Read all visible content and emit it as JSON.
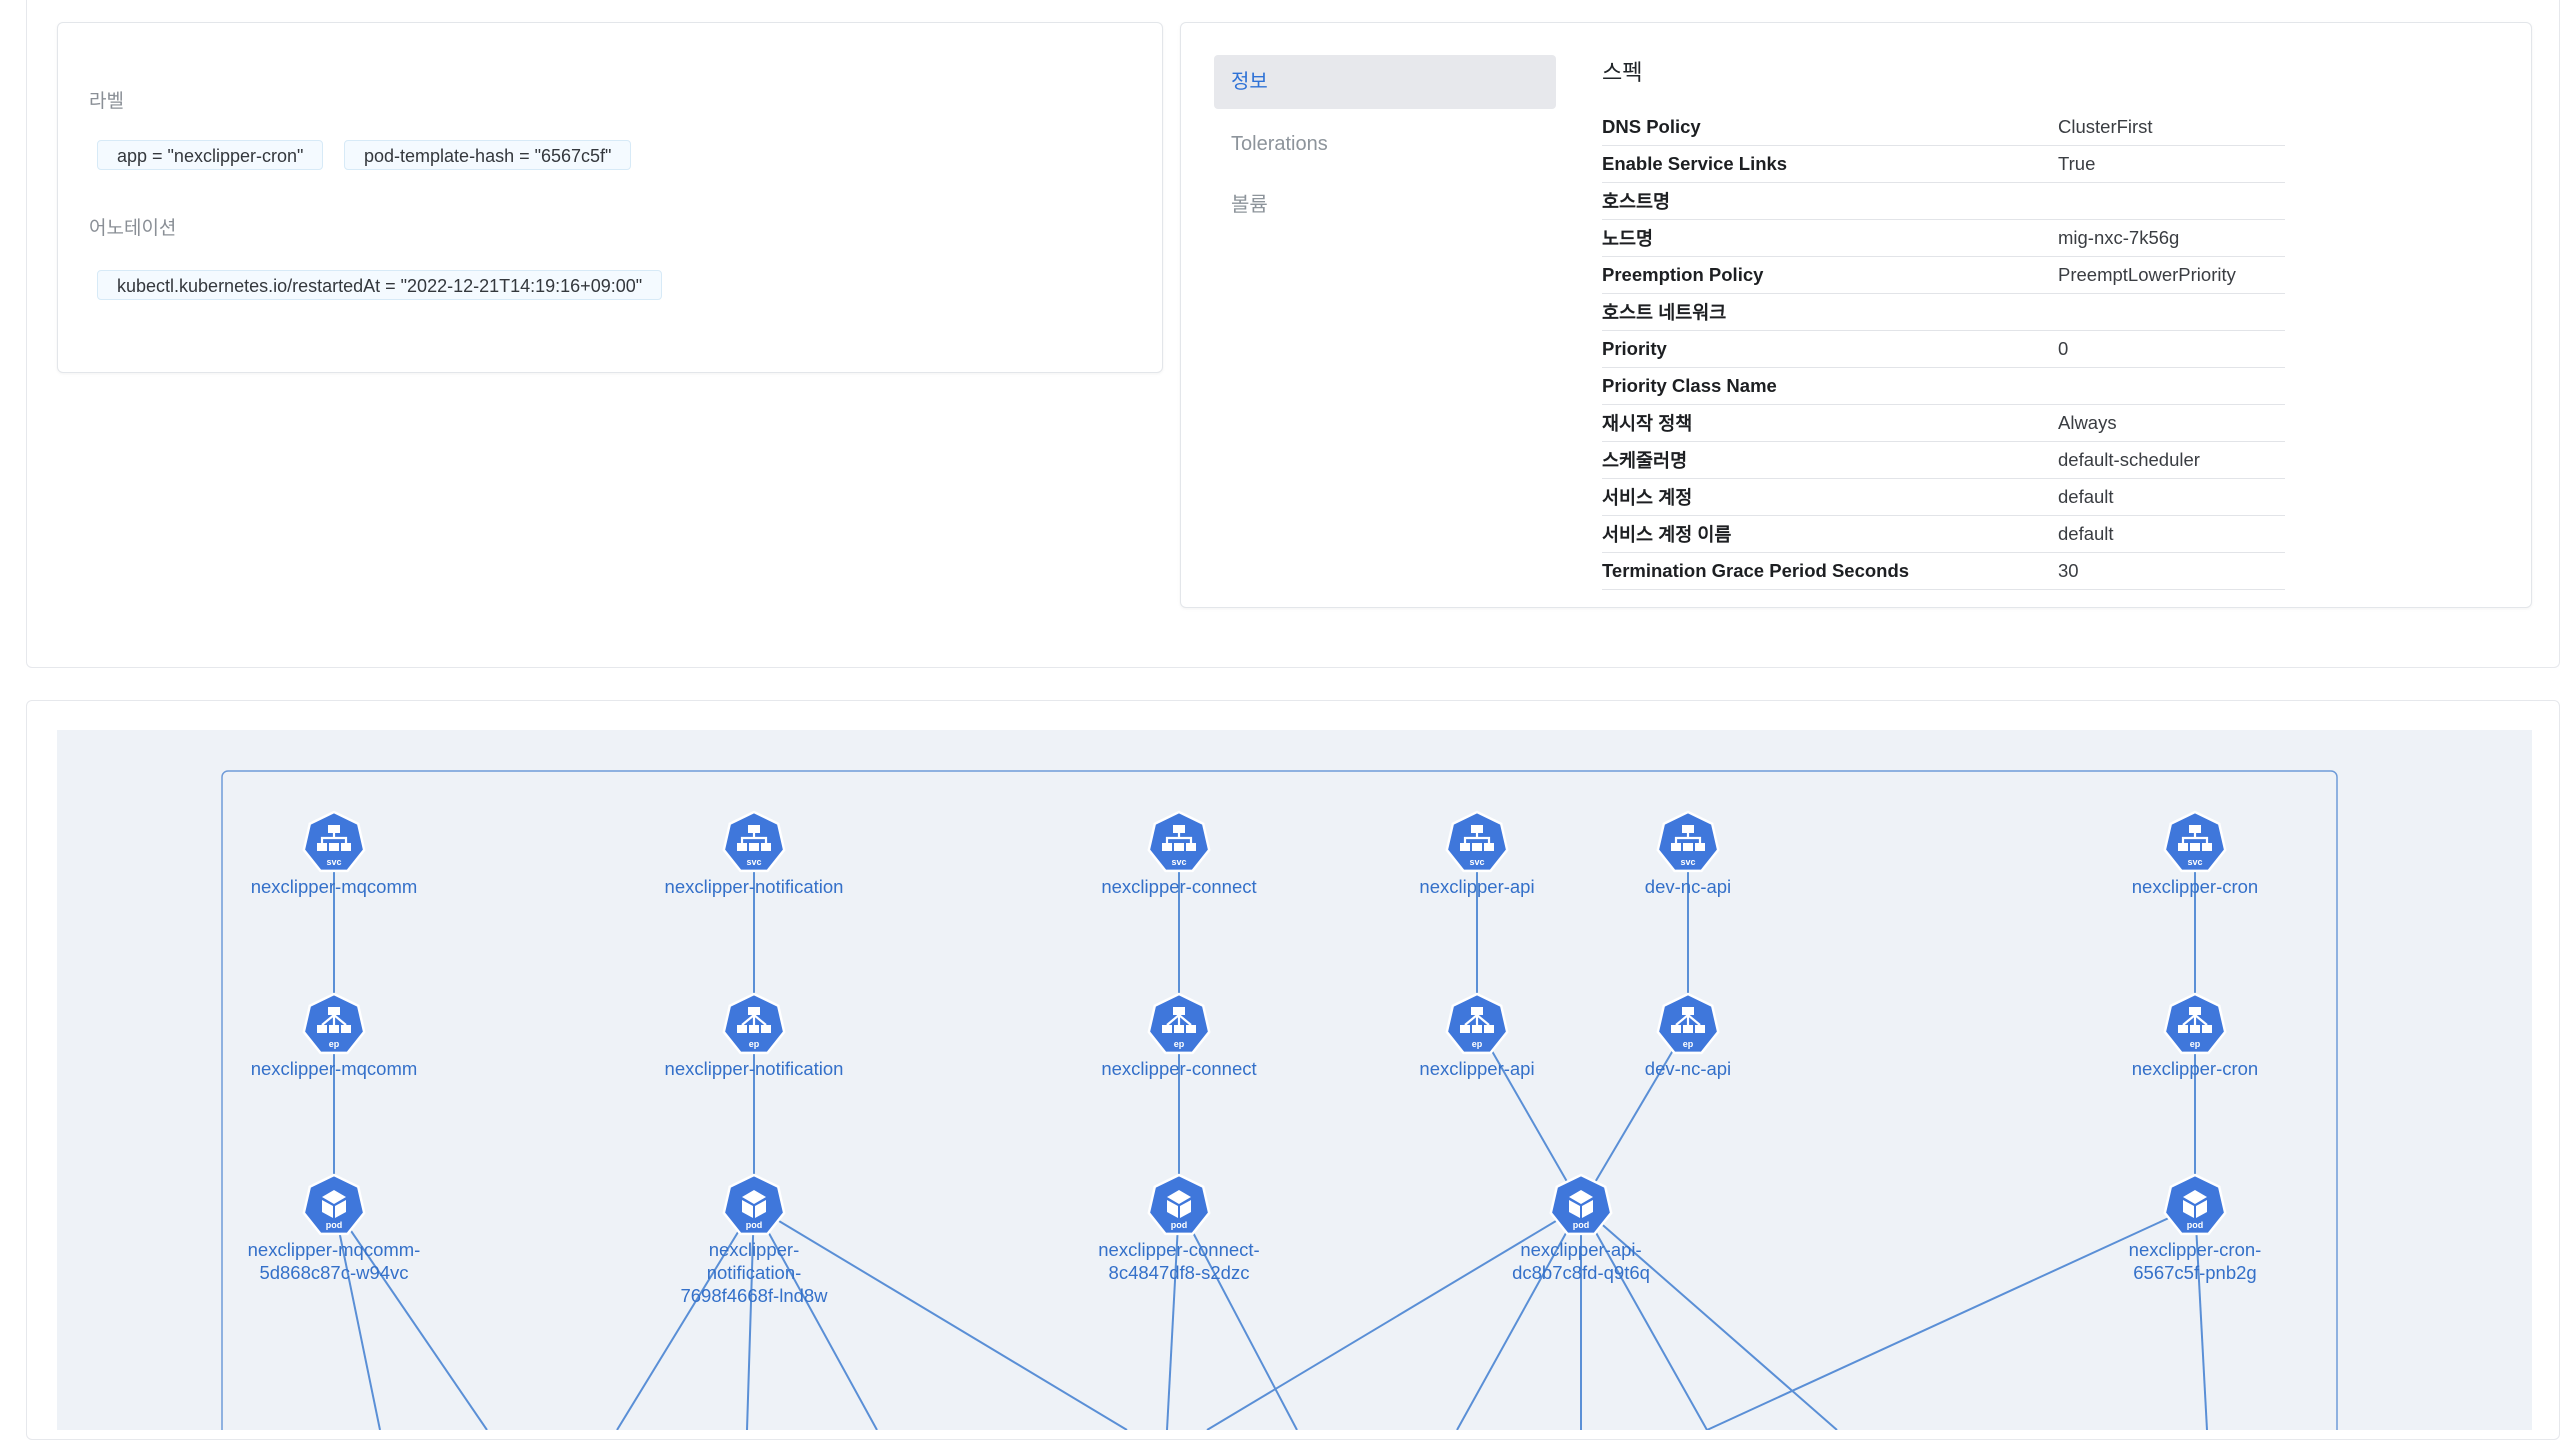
{
  "metadata": {
    "labels_heading": "라벨",
    "labels": [
      "app = \"nexclipper-cron\"",
      "pod-template-hash = \"6567c5f\""
    ],
    "annotations_heading": "어노테이션",
    "annotations": [
      "kubectl.kubernetes.io/restartedAt = \"2022-12-21T14:19:16+09:00\""
    ]
  },
  "tabs": [
    {
      "label": "정보",
      "active": true
    },
    {
      "label": "Tolerations",
      "active": false
    },
    {
      "label": "볼륨",
      "active": false
    }
  ],
  "spec": {
    "title": "스펙",
    "rows": [
      {
        "key": "DNS Policy",
        "value": "ClusterFirst"
      },
      {
        "key": "Enable Service Links",
        "value": "True"
      },
      {
        "key": "호스트명",
        "value": ""
      },
      {
        "key": "노드명",
        "value": "mig-nxc-7k56g"
      },
      {
        "key": "Preemption Policy",
        "value": "PreemptLowerPriority"
      },
      {
        "key": "호스트 네트워크",
        "value": ""
      },
      {
        "key": "Priority",
        "value": "0"
      },
      {
        "key": "Priority Class Name",
        "value": ""
      },
      {
        "key": "재시작 정책",
        "value": "Always"
      },
      {
        "key": "스케줄러명",
        "value": "default-scheduler"
      },
      {
        "key": "서비스 계정",
        "value": "default"
      },
      {
        "key": "서비스 계정 이름",
        "value": "default"
      },
      {
        "key": "Termination Grace Period Seconds",
        "value": "30"
      }
    ]
  },
  "topology": {
    "colors": {
      "node": "#3f77db",
      "edge": "#5a8fd6",
      "label": "#3470c9",
      "group_border": "#6f9bd8",
      "canvas": "#eef2f7"
    },
    "nodes": [
      {
        "id": "svc-mqcomm",
        "type": "svc",
        "icon": "svc",
        "label": [
          "nexclipper-mqcomm"
        ]
      },
      {
        "id": "svc-notification",
        "type": "svc",
        "icon": "svc",
        "label": [
          "nexclipper-notification"
        ]
      },
      {
        "id": "svc-connect",
        "type": "svc",
        "icon": "svc",
        "label": [
          "nexclipper-connect"
        ]
      },
      {
        "id": "svc-api",
        "type": "svc",
        "icon": "svc",
        "label": [
          "nexclipper-api"
        ]
      },
      {
        "id": "svc-devncapi",
        "type": "svc",
        "icon": "svc",
        "label": [
          "dev-nc-api"
        ]
      },
      {
        "id": "svc-cron",
        "type": "svc",
        "icon": "svc",
        "label": [
          "nexclipper-cron"
        ]
      },
      {
        "id": "ep-mqcomm",
        "type": "ep",
        "icon": "ep",
        "label": [
          "nexclipper-mqcomm"
        ]
      },
      {
        "id": "ep-notification",
        "type": "ep",
        "icon": "ep",
        "label": [
          "nexclipper-notification"
        ]
      },
      {
        "id": "ep-connect",
        "type": "ep",
        "icon": "ep",
        "label": [
          "nexclipper-connect"
        ]
      },
      {
        "id": "ep-api",
        "type": "ep",
        "icon": "ep",
        "label": [
          "nexclipper-api"
        ]
      },
      {
        "id": "ep-devncapi",
        "type": "ep",
        "icon": "ep",
        "label": [
          "dev-nc-api"
        ]
      },
      {
        "id": "ep-cron",
        "type": "ep",
        "icon": "ep",
        "label": [
          "nexclipper-cron"
        ]
      },
      {
        "id": "pod-mqcomm",
        "type": "pod",
        "icon": "pod",
        "label": [
          "nexclipper-mqcomm-",
          "5d868c87c-w94vc"
        ]
      },
      {
        "id": "pod-notification",
        "type": "pod",
        "icon": "pod",
        "label": [
          "nexclipper-",
          "notification-",
          "7698f4668f-lnd8w"
        ]
      },
      {
        "id": "pod-connect",
        "type": "pod",
        "icon": "pod",
        "label": [
          "nexclipper-connect-",
          "8c4847df8-s2dzc"
        ]
      },
      {
        "id": "pod-api",
        "type": "pod",
        "icon": "pod",
        "label": [
          "nexclipper-api-",
          "dc8b7c8fd-q9t6q"
        ]
      },
      {
        "id": "pod-cron",
        "type": "pod",
        "icon": "pod",
        "label": [
          "nexclipper-cron-",
          "6567c5f-pnb2g"
        ]
      }
    ],
    "edges": [
      [
        "svc-mqcomm",
        "ep-mqcomm"
      ],
      [
        "ep-mqcomm",
        "pod-mqcomm"
      ],
      [
        "svc-notification",
        "ep-notification"
      ],
      [
        "ep-notification",
        "pod-notification"
      ],
      [
        "svc-connect",
        "ep-connect"
      ],
      [
        "ep-connect",
        "pod-connect"
      ],
      [
        "svc-api",
        "ep-api"
      ],
      [
        "ep-api",
        "pod-api"
      ],
      [
        "svc-devncapi",
        "ep-devncapi"
      ],
      [
        "ep-devncapi",
        "pod-api"
      ],
      [
        "svc-cron",
        "ep-cron"
      ],
      [
        "ep-cron",
        "pod-cron"
      ]
    ]
  }
}
